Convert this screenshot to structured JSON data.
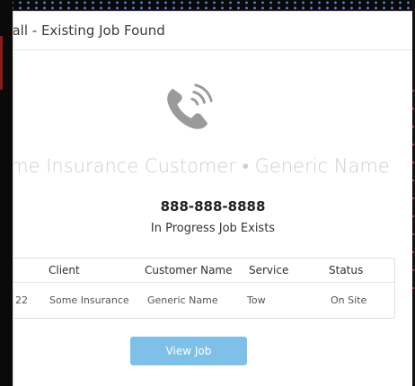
{
  "modal": {
    "title": "Call - Existing Job Found",
    "caller": "Some Insurance Customer • Generic Name",
    "phone": "888-888-8888",
    "job_status": "In Progress Job Exists",
    "view_job_label": "View Job"
  },
  "table": {
    "headers": {
      "client": "Client",
      "customer_name": "Customer Name",
      "service": "Service",
      "status": "Status"
    },
    "rows": [
      {
        "id": "22",
        "client": "Some Insurance",
        "customer_name": "Generic Name",
        "service": "Tow",
        "status": "On Site"
      }
    ]
  },
  "colors": {
    "accent_button": "#7ec0e8",
    "icon": "#9a9a9a"
  },
  "icons": {
    "phone": "phone-ringing-icon"
  }
}
